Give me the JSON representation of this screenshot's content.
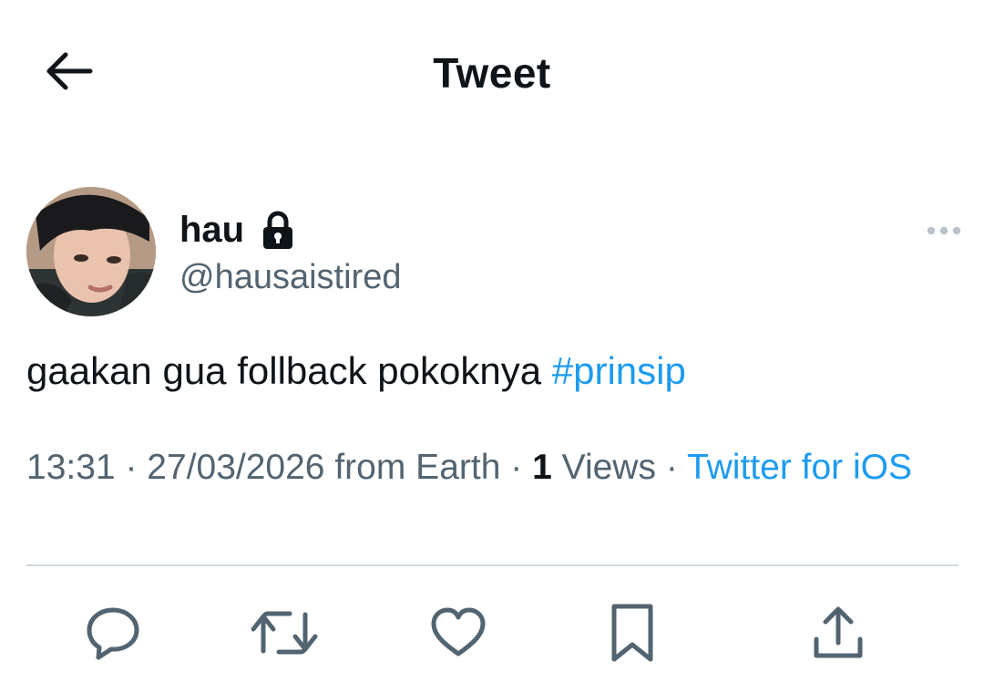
{
  "header": {
    "title": "Tweet",
    "back_icon": "arrow-left-icon"
  },
  "author": {
    "display_name": "hau",
    "protected_icon": "lock-icon",
    "handle": "@hausaistired"
  },
  "tweet": {
    "text": "gaakan gua follback pokoknya",
    "hashtag": "#prinsip"
  },
  "meta": {
    "time": "13:31",
    "date": "27/03/2026",
    "location": "from Earth",
    "separator": "·",
    "views_count": "1",
    "views_label": "Views",
    "source": "Twitter for iOS"
  },
  "actions": [
    {
      "name": "reply",
      "icon": "reply-icon"
    },
    {
      "name": "retweet",
      "icon": "retweet-icon"
    },
    {
      "name": "like",
      "icon": "heart-icon"
    },
    {
      "name": "bookmark",
      "icon": "bookmark-icon"
    },
    {
      "name": "share",
      "icon": "share-icon"
    }
  ],
  "colors": {
    "text": "#0f1419",
    "secondary": "#536471",
    "accent": "#1d9bf0",
    "divider": "#cfd9de"
  }
}
